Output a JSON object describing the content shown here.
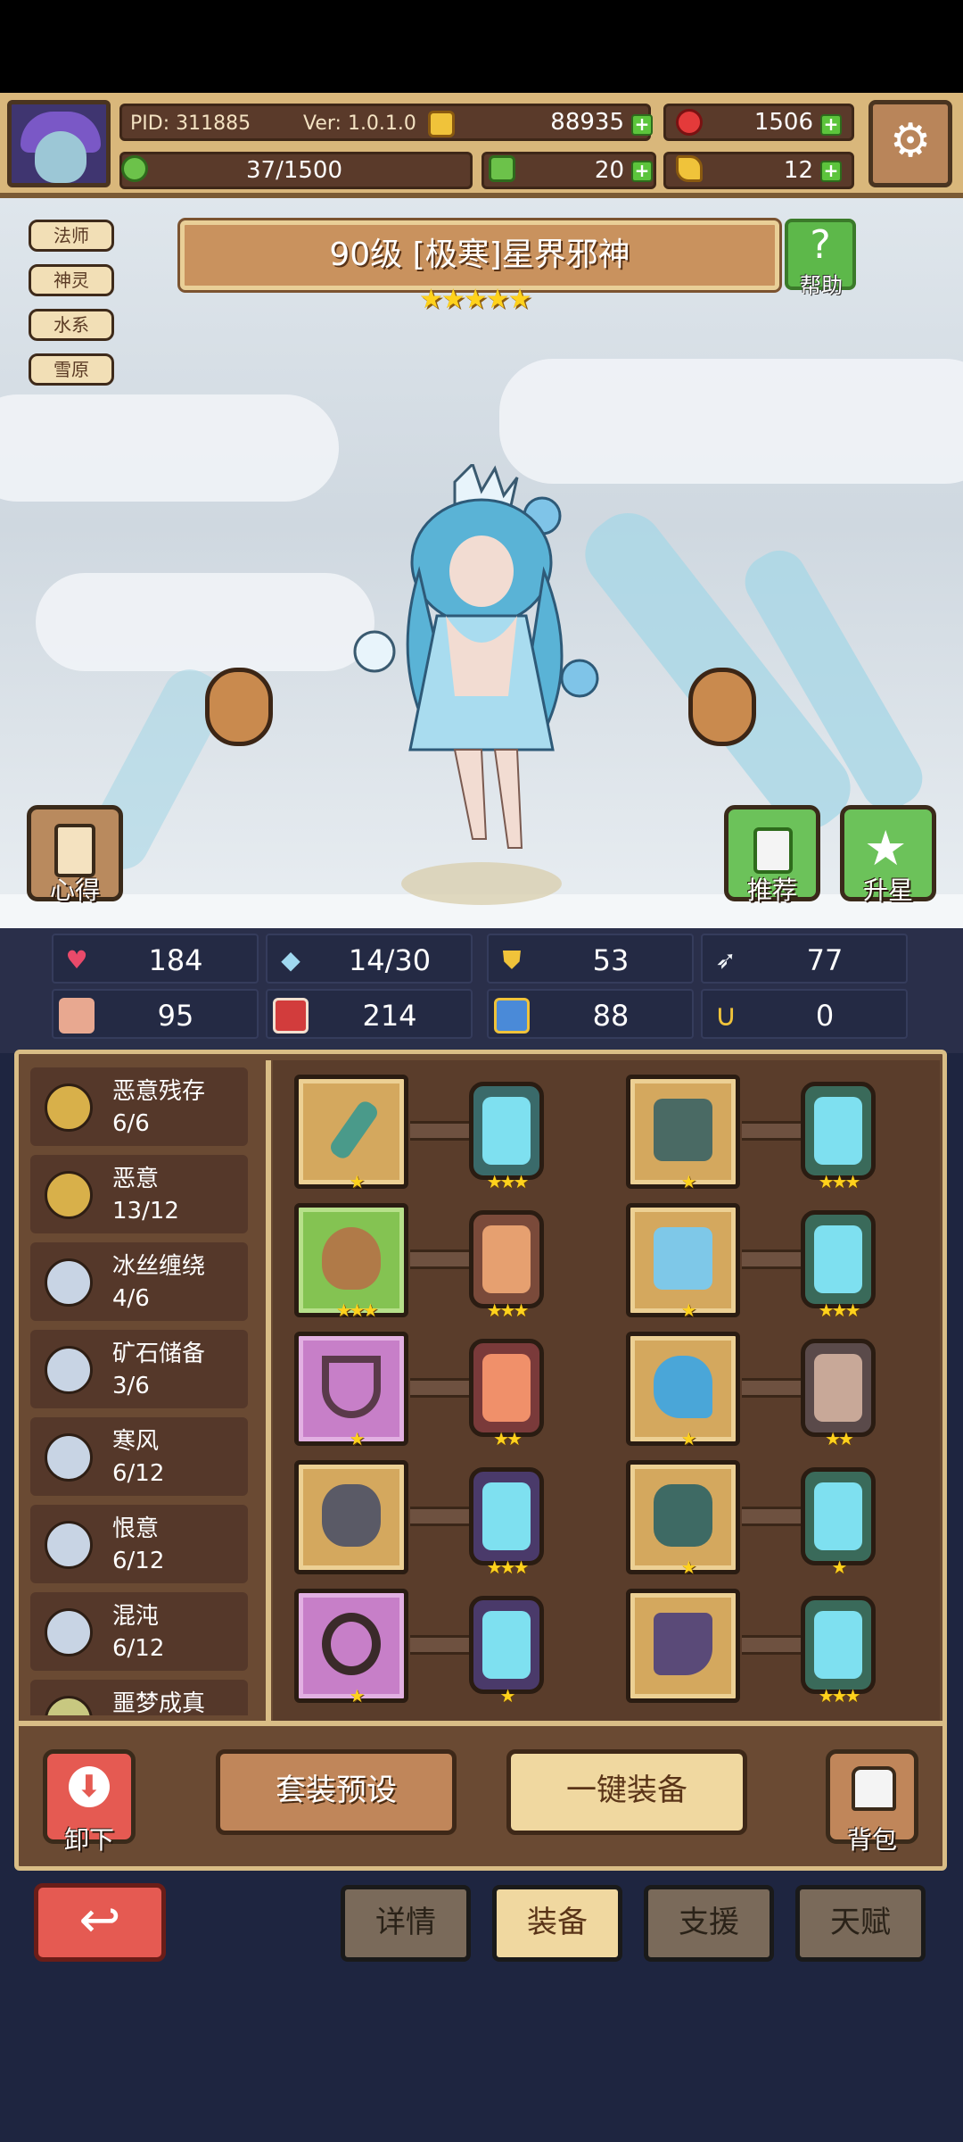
{
  "header": {
    "pid": "PID: 311885",
    "version": "Ver: 1.0.1.0",
    "gold": "88935",
    "gems": "1506",
    "stamina": "37/1500",
    "clover": "20",
    "key": "12"
  },
  "hero": {
    "tags": [
      "法师",
      "神灵",
      "水系",
      "雪原"
    ],
    "title": "90级 [极寒]星界邪神",
    "stars": "★★★★★",
    "help_label": "帮助",
    "notes_label": "心得",
    "recommend_label": "推荐",
    "star_up_label": "升星"
  },
  "stats": [
    {
      "icon": "heart-icon",
      "value": "184"
    },
    {
      "icon": "mana-drop-icon",
      "value": "14/30"
    },
    {
      "icon": "shield-icon",
      "value": "53"
    },
    {
      "icon": "wing-icon",
      "value": "77"
    },
    {
      "icon": "fist-icon",
      "value": "95"
    },
    {
      "icon": "book-icon",
      "value": "214"
    },
    {
      "icon": "boot-icon",
      "value": "88"
    },
    {
      "icon": "horseshoe-icon",
      "value": "0"
    }
  ],
  "sets": [
    {
      "name": "恶意残存",
      "count": "6/6"
    },
    {
      "name": "恶意",
      "count": "13/12"
    },
    {
      "name": "冰丝缠绕",
      "count": "4/6"
    },
    {
      "name": "矿石储备",
      "count": "3/6"
    },
    {
      "name": "寒风",
      "count": "6/12"
    },
    {
      "name": "恨意",
      "count": "6/12"
    },
    {
      "name": "混沌",
      "count": "6/12"
    },
    {
      "name": "噩梦成真",
      "count": ""
    }
  ],
  "equipment": {
    "left": [
      {
        "item": "staff",
        "frame": "gold",
        "stars": "★",
        "rune_stars": "★★★"
      },
      {
        "item": "pouch",
        "frame": "green",
        "stars": "★★★",
        "rune_stars": "★★★"
      },
      {
        "item": "amulet",
        "frame": "purple",
        "stars": "★",
        "rune_stars": "★★"
      },
      {
        "item": "orb",
        "frame": "gold",
        "stars": "",
        "rune_stars": "★★★"
      },
      {
        "item": "ring",
        "frame": "purple",
        "stars": "★",
        "rune_stars": "★"
      }
    ],
    "right": [
      {
        "item": "cloak",
        "frame": "gold",
        "stars": "★",
        "rune_stars": "★★★"
      },
      {
        "item": "robe",
        "frame": "gold",
        "stars": "★",
        "rune_stars": "★★★"
      },
      {
        "item": "glove",
        "frame": "gold",
        "stars": "★",
        "rune_stars": "★★"
      },
      {
        "item": "belt",
        "frame": "gold",
        "stars": "★",
        "rune_stars": "★"
      },
      {
        "item": "boots",
        "frame": "gold",
        "stars": "",
        "rune_stars": "★★★"
      }
    ]
  },
  "actions": {
    "unequip": "卸下",
    "set_preset": "套装预设",
    "auto_equip": "一键装备",
    "backpack": "背包"
  },
  "tabs": [
    "详情",
    "装备",
    "支援",
    "天赋"
  ],
  "colors": {
    "accent_gold": "#ffd21c",
    "plus_green": "#5cc43c",
    "back_red": "#e55a52"
  }
}
